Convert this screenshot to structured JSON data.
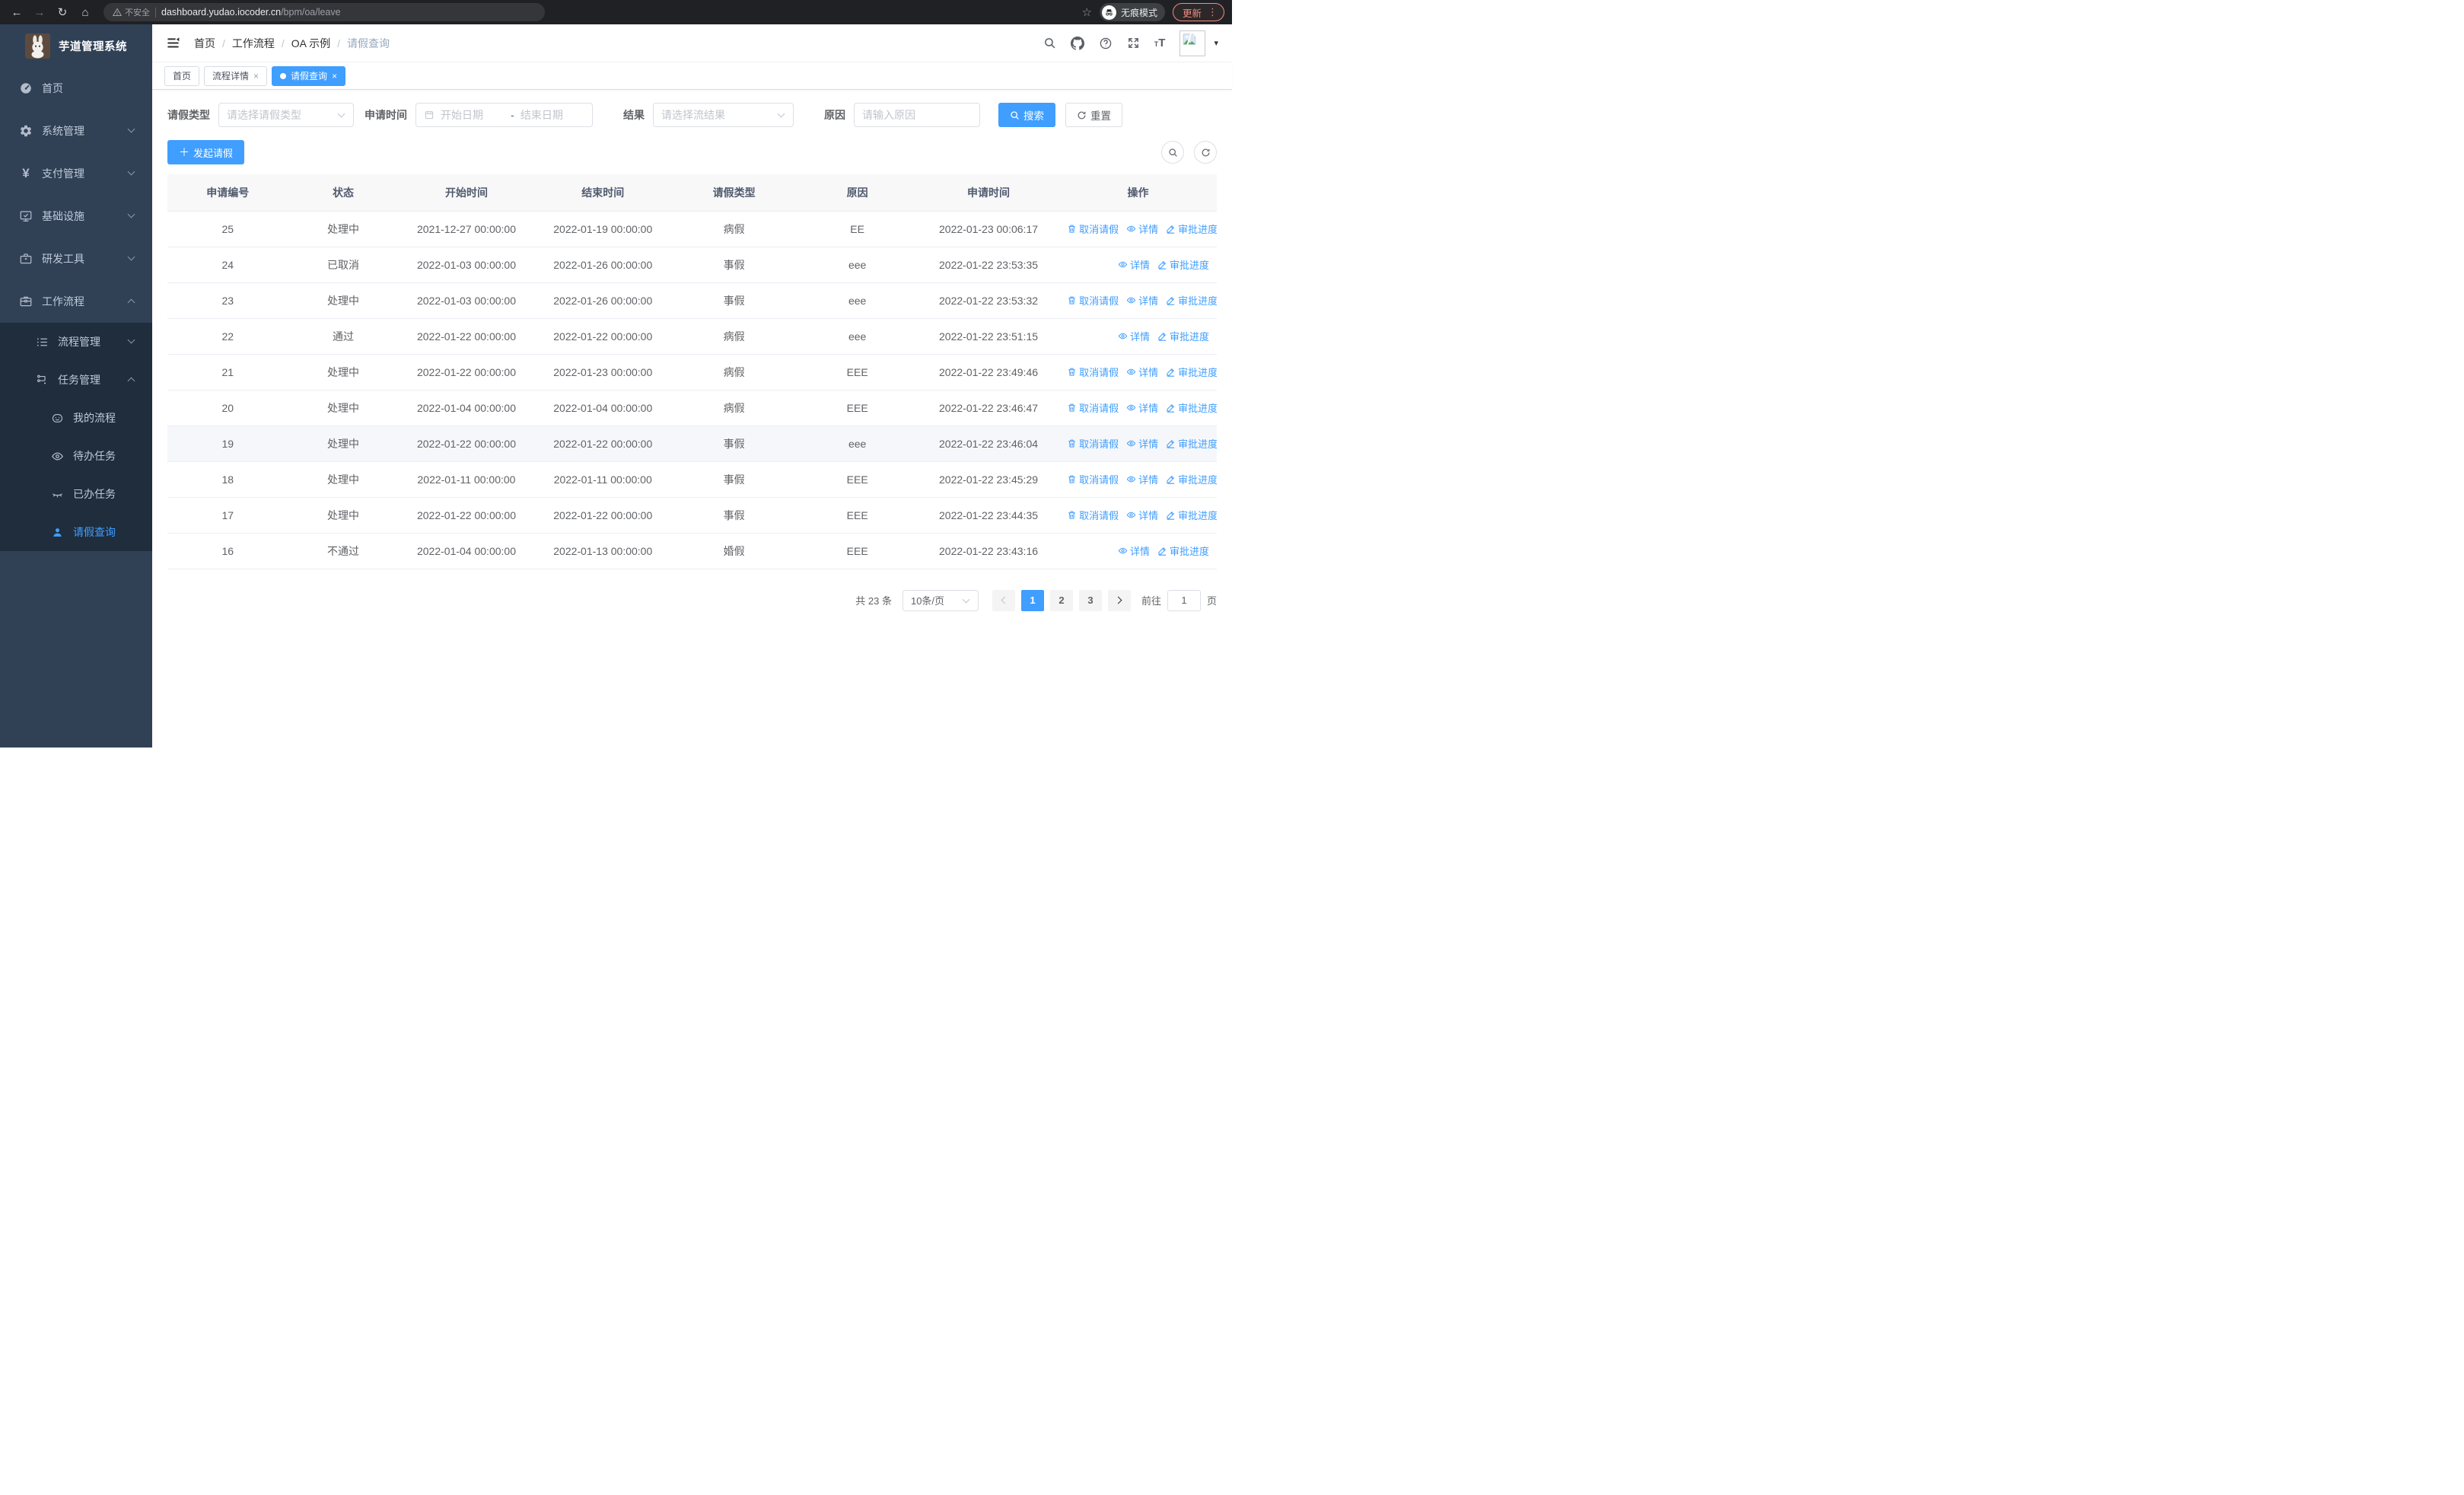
{
  "colors": {
    "primary": "#409eff",
    "chrome_bg": "#202124",
    "sidebar_bg": "#304156",
    "submenu_bg": "#1f2d3d",
    "active_text": "#409eff",
    "update_accent": "#f28b82"
  },
  "browser": {
    "security_label": "不安全",
    "url_host": "dashboard.yudao.iocoder.cn",
    "url_path": "/bpm/oa/leave",
    "incognito_label": "无痕模式",
    "update_label": "更新"
  },
  "sidebar": {
    "app_title": "芋道管理系统",
    "items": [
      {
        "label": "首页"
      },
      {
        "label": "系统管理"
      },
      {
        "label": "支付管理"
      },
      {
        "label": "基础设施"
      },
      {
        "label": "研发工具"
      },
      {
        "label": "工作流程"
      },
      {
        "label": "流程管理"
      },
      {
        "label": "任务管理"
      },
      {
        "label": "我的流程"
      },
      {
        "label": "待办任务"
      },
      {
        "label": "已办任务"
      },
      {
        "label": "请假查询"
      }
    ]
  },
  "header": {
    "breadcrumb": [
      "首页",
      "工作流程",
      "OA 示例",
      "请假查询"
    ]
  },
  "tabs": [
    {
      "label": "首页",
      "closable": false,
      "active": false
    },
    {
      "label": "流程详情",
      "closable": true,
      "active": false
    },
    {
      "label": "请假查询",
      "closable": true,
      "active": true
    }
  ],
  "filters": {
    "leave_type_label": "请假类型",
    "leave_type_placeholder": "请选择请假类型",
    "apply_time_label": "申请时间",
    "start_placeholder": "开始日期",
    "range_separator": "-",
    "end_placeholder": "结束日期",
    "result_label": "结果",
    "result_placeholder": "请选择流结果",
    "reason_label": "原因",
    "reason_placeholder": "请输入原因",
    "search_label": "搜索",
    "reset_label": "重置"
  },
  "toolbar": {
    "create_label": "发起请假"
  },
  "table": {
    "columns": [
      "申请编号",
      "状态",
      "开始时间",
      "结束时间",
      "请假类型",
      "原因",
      "申请时间",
      "操作"
    ],
    "actions": {
      "cancel": "取消请假",
      "detail": "详情",
      "progress": "审批进度"
    },
    "rows": [
      {
        "id": "25",
        "status": "处理中",
        "start": "2021-12-27 00:00:00",
        "end": "2022-01-19 00:00:00",
        "type": "病假",
        "reason": "EE",
        "apply_time": "2022-01-23 00:06:17",
        "cancellable": true,
        "highlighted": false
      },
      {
        "id": "24",
        "status": "已取消",
        "start": "2022-01-03 00:00:00",
        "end": "2022-01-26 00:00:00",
        "type": "事假",
        "reason": "eee",
        "apply_time": "2022-01-22 23:53:35",
        "cancellable": false,
        "highlighted": false
      },
      {
        "id": "23",
        "status": "处理中",
        "start": "2022-01-03 00:00:00",
        "end": "2022-01-26 00:00:00",
        "type": "事假",
        "reason": "eee",
        "apply_time": "2022-01-22 23:53:32",
        "cancellable": true,
        "highlighted": false
      },
      {
        "id": "22",
        "status": "通过",
        "start": "2022-01-22 00:00:00",
        "end": "2022-01-22 00:00:00",
        "type": "病假",
        "reason": "eee",
        "apply_time": "2022-01-22 23:51:15",
        "cancellable": false,
        "highlighted": false
      },
      {
        "id": "21",
        "status": "处理中",
        "start": "2022-01-22 00:00:00",
        "end": "2022-01-23 00:00:00",
        "type": "病假",
        "reason": "EEE",
        "apply_time": "2022-01-22 23:49:46",
        "cancellable": true,
        "highlighted": false
      },
      {
        "id": "20",
        "status": "处理中",
        "start": "2022-01-04 00:00:00",
        "end": "2022-01-04 00:00:00",
        "type": "病假",
        "reason": "EEE",
        "apply_time": "2022-01-22 23:46:47",
        "cancellable": true,
        "highlighted": false
      },
      {
        "id": "19",
        "status": "处理中",
        "start": "2022-01-22 00:00:00",
        "end": "2022-01-22 00:00:00",
        "type": "事假",
        "reason": "eee",
        "apply_time": "2022-01-22 23:46:04",
        "cancellable": true,
        "highlighted": true
      },
      {
        "id": "18",
        "status": "处理中",
        "start": "2022-01-11 00:00:00",
        "end": "2022-01-11 00:00:00",
        "type": "事假",
        "reason": "EEE",
        "apply_time": "2022-01-22 23:45:29",
        "cancellable": true,
        "highlighted": false
      },
      {
        "id": "17",
        "status": "处理中",
        "start": "2022-01-22 00:00:00",
        "end": "2022-01-22 00:00:00",
        "type": "事假",
        "reason": "EEE",
        "apply_time": "2022-01-22 23:44:35",
        "cancellable": true,
        "highlighted": false
      },
      {
        "id": "16",
        "status": "不通过",
        "start": "2022-01-04 00:00:00",
        "end": "2022-01-13 00:00:00",
        "type": "婚假",
        "reason": "EEE",
        "apply_time": "2022-01-22 23:43:16",
        "cancellable": false,
        "highlighted": false
      }
    ]
  },
  "pagination": {
    "total": "共 23 条",
    "page_size": "10条/页",
    "pages": [
      "1",
      "2",
      "3"
    ],
    "active_page": "1",
    "goto_label": "前往",
    "goto_value": "1",
    "unit_label": "页"
  }
}
